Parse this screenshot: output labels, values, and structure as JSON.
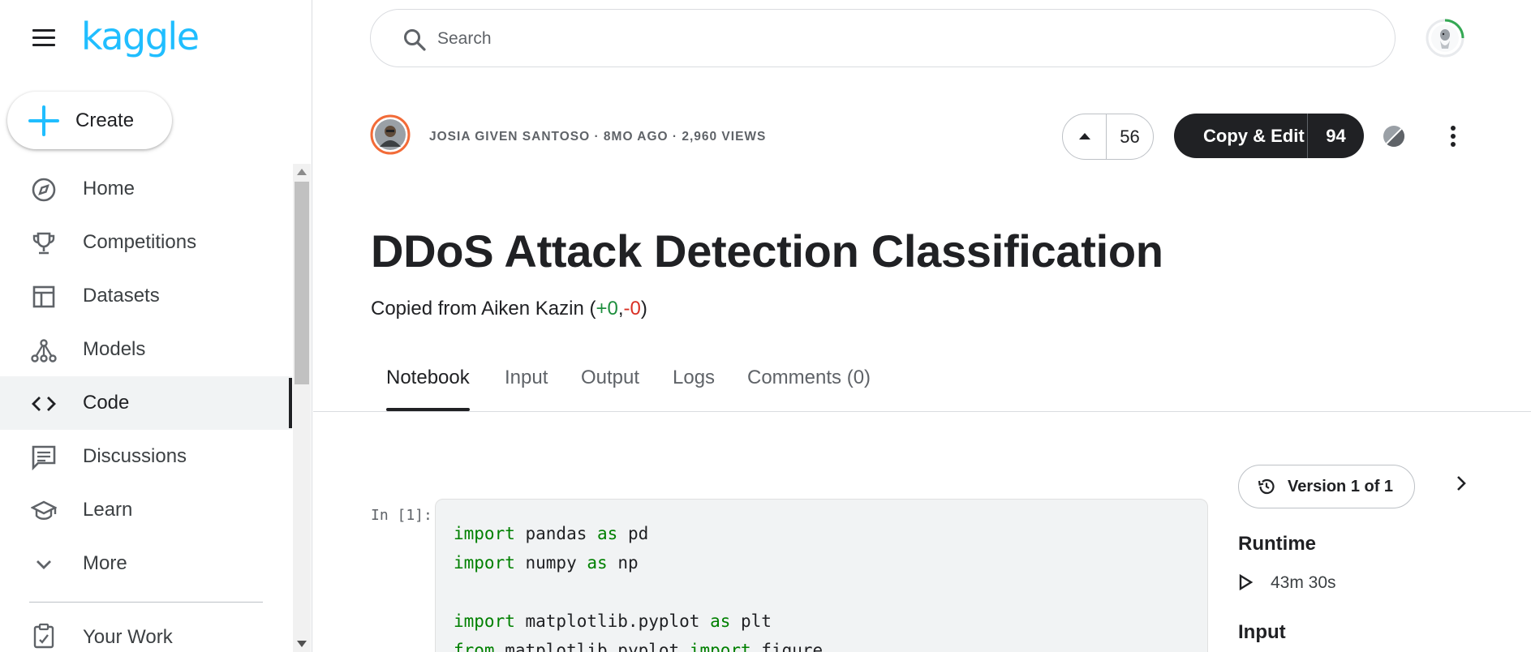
{
  "brand": {
    "logo_text": "kaggle",
    "accent_color": "#20beff"
  },
  "sidebar": {
    "create_label": "Create",
    "items": [
      {
        "label": "Home",
        "icon": "compass-icon"
      },
      {
        "label": "Competitions",
        "icon": "trophy-icon"
      },
      {
        "label": "Datasets",
        "icon": "table-icon"
      },
      {
        "label": "Models",
        "icon": "models-icon"
      },
      {
        "label": "Code",
        "icon": "code-icon",
        "active": true
      },
      {
        "label": "Discussions",
        "icon": "comment-icon"
      },
      {
        "label": "Learn",
        "icon": "school-icon"
      },
      {
        "label": "More",
        "icon": "chevron-down-icon"
      }
    ],
    "your_work_label": "Your Work"
  },
  "search": {
    "placeholder": "Search"
  },
  "notebook": {
    "meta": "JOSIA GIVEN SANTOSO · 8MO AGO · 2,960 VIEWS",
    "votes": "56",
    "copy_edit_label": "Copy & Edit",
    "copy_edit_count": "94",
    "title": "DDoS Attack Detection Classification",
    "copied_prefix": "Copied from Aiken Kazin (",
    "copied_pos": "+0",
    "copied_sep": ",",
    "copied_neg": "-0",
    "copied_suffix": ")"
  },
  "tabs": [
    "Notebook",
    "Input",
    "Output",
    "Logs",
    "Comments (0)"
  ],
  "cell": {
    "prompt": "In [1]:",
    "lines": [
      [
        {
          "t": "import",
          "k": true
        },
        {
          "t": " pandas "
        },
        {
          "t": "as",
          "k": true
        },
        {
          "t": " pd"
        }
      ],
      [
        {
          "t": "import",
          "k": true
        },
        {
          "t": " numpy "
        },
        {
          "t": "as",
          "k": true
        },
        {
          "t": " np"
        }
      ],
      [
        {
          "t": ""
        }
      ],
      [
        {
          "t": "import",
          "k": true
        },
        {
          "t": " matplotlib.pyplot "
        },
        {
          "t": "as",
          "k": true
        },
        {
          "t": " plt"
        }
      ],
      [
        {
          "t": "from",
          "k": true
        },
        {
          "t": " matplotlib.pyplot "
        },
        {
          "t": "import",
          "k": true
        },
        {
          "t": " figure"
        }
      ]
    ]
  },
  "right_panel": {
    "version_label": "Version 1 of 1",
    "runtime_heading": "Runtime",
    "runtime_value": "43m 30s",
    "input_heading": "Input"
  }
}
